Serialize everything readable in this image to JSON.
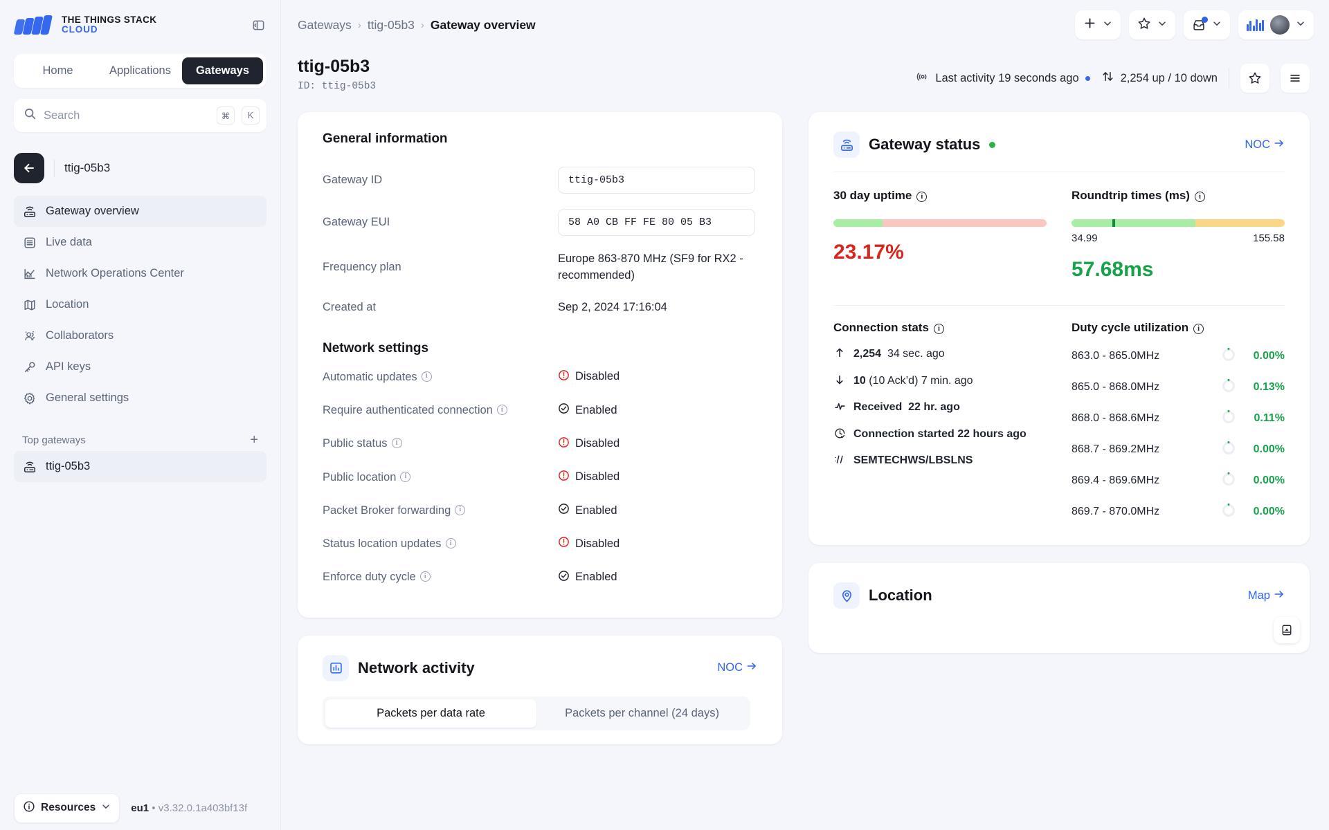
{
  "brand": {
    "line1": "THE THINGS STACK",
    "line2": "CLOUD"
  },
  "sidebar": {
    "segments": [
      {
        "label": "Home",
        "active": false
      },
      {
        "label": "Applications",
        "active": false
      },
      {
        "label": "Gateways",
        "active": true
      }
    ],
    "search": {
      "placeholder": "Search",
      "value": "",
      "kbd1": "⌘",
      "kbd2": "K"
    },
    "context_name": "ttig-05b3",
    "nav": [
      {
        "label": "Gateway overview",
        "icon": "gateway-icon",
        "active": true
      },
      {
        "label": "Live data",
        "icon": "list-icon",
        "active": false
      },
      {
        "label": "Network Operations Center",
        "icon": "chart-icon",
        "active": false
      },
      {
        "label": "Location",
        "icon": "map-icon",
        "active": false
      },
      {
        "label": "Collaborators",
        "icon": "users-icon",
        "active": false
      },
      {
        "label": "API keys",
        "icon": "key-icon",
        "active": false
      },
      {
        "label": "General settings",
        "icon": "gear-icon",
        "active": false
      }
    ],
    "group_title": "Top gateways",
    "group_items": [
      {
        "label": "ttig-05b3",
        "icon": "gateway-icon"
      }
    ],
    "footer": {
      "resources_label": "Resources",
      "cluster": "eu1",
      "sep": "•",
      "version": "v3.32.0.1a403bf13f"
    }
  },
  "topbar": {
    "breadcrumb": [
      "Gateways",
      "ttig-05b3",
      "Gateway overview"
    ],
    "sep": "›",
    "actions": [
      {
        "name": "add-button",
        "icon": "plus-icon"
      },
      {
        "name": "bookmarks-button",
        "icon": "star-icon"
      },
      {
        "name": "notifications-button",
        "icon": "inbox-icon"
      },
      {
        "name": "profile-button",
        "icon": "avatar"
      }
    ]
  },
  "pagehead": {
    "title": "ttig-05b3",
    "id_label": "ID: ttig-05b3",
    "last_activity": "Last activity 19 seconds ago",
    "traffic": "2,254 up / 10 down"
  },
  "general": {
    "title": "General information",
    "rows": [
      {
        "label": "Gateway ID",
        "value": "ttig-05b3",
        "type": "input"
      },
      {
        "label": "Gateway EUI",
        "value": "58 A0 CB FF FE 80 05 B3",
        "type": "input"
      },
      {
        "label": "Frequency plan",
        "value": "Europe 863-870 MHz (SF9 for RX2 - recommended)",
        "type": "text"
      },
      {
        "label": "Created at",
        "value": "Sep 2, 2024 17:16:04",
        "type": "text"
      }
    ],
    "network_title": "Network settings",
    "settings": [
      {
        "label": "Automatic updates",
        "value": "Disabled",
        "state": "disabled"
      },
      {
        "label": "Require authenticated connection",
        "value": "Enabled",
        "state": "enabled"
      },
      {
        "label": "Public status",
        "value": "Disabled",
        "state": "disabled"
      },
      {
        "label": "Public location",
        "value": "Disabled",
        "state": "disabled"
      },
      {
        "label": "Packet Broker forwarding",
        "value": "Enabled",
        "state": "enabled"
      },
      {
        "label": "Status location updates",
        "value": "Disabled",
        "state": "disabled"
      },
      {
        "label": "Enforce duty cycle",
        "value": "Enabled",
        "state": "enabled"
      }
    ]
  },
  "status": {
    "title": "Gateway status",
    "noc_label": "NOC",
    "uptime": {
      "label": "30 day uptime",
      "value": "23.17%",
      "percent": 23.17
    },
    "roundtrip": {
      "label": "Roundtrip times (ms)",
      "value": "57.68ms",
      "min": "34.99",
      "max": "155.58",
      "green_percent": 58,
      "marker_percent": 19
    },
    "conn": {
      "label": "Connection stats",
      "items": [
        {
          "icon": "arrow-up-icon",
          "strong": "2,254",
          "rest": "34 sec. ago"
        },
        {
          "icon": "arrow-down-icon",
          "strong": "10",
          "rest": "(10 Ack’d)  7 min. ago"
        },
        {
          "icon": "pulse-icon",
          "strong": "Received",
          "rest": "22 hr. ago"
        },
        {
          "icon": "clock-icon",
          "strong": "Connection started 22 hours ago",
          "rest": ""
        },
        {
          "icon": "protocol-icon",
          "strong": "SEMTECHWS/LBSLNS",
          "rest": ""
        }
      ]
    },
    "duty": {
      "label": "Duty cycle utilization",
      "rows": [
        {
          "band": "863.0 - 865.0MHz",
          "pct": "0.00%"
        },
        {
          "band": "865.0 - 868.0MHz",
          "pct": "0.13%"
        },
        {
          "band": "868.0 - 868.6MHz",
          "pct": "0.11%"
        },
        {
          "band": "868.7 - 869.2MHz",
          "pct": "0.00%"
        },
        {
          "band": "869.4 - 869.6MHz",
          "pct": "0.00%"
        },
        {
          "band": "869.7 - 870.0MHz",
          "pct": "0.00%"
        }
      ]
    }
  },
  "activity": {
    "title": "Network activity",
    "noc_label": "NOC",
    "tabs": [
      {
        "label": "Packets per data rate",
        "active": true
      },
      {
        "label": "Packets per channel (24 days)",
        "active": false
      }
    ]
  },
  "location": {
    "title": "Location",
    "map_label": "Map"
  },
  "colors": {
    "accent": "#3568ef",
    "link": "#2f62ee",
    "danger": "#d9261c",
    "success": "#16a34a",
    "dark": "#20242f"
  }
}
